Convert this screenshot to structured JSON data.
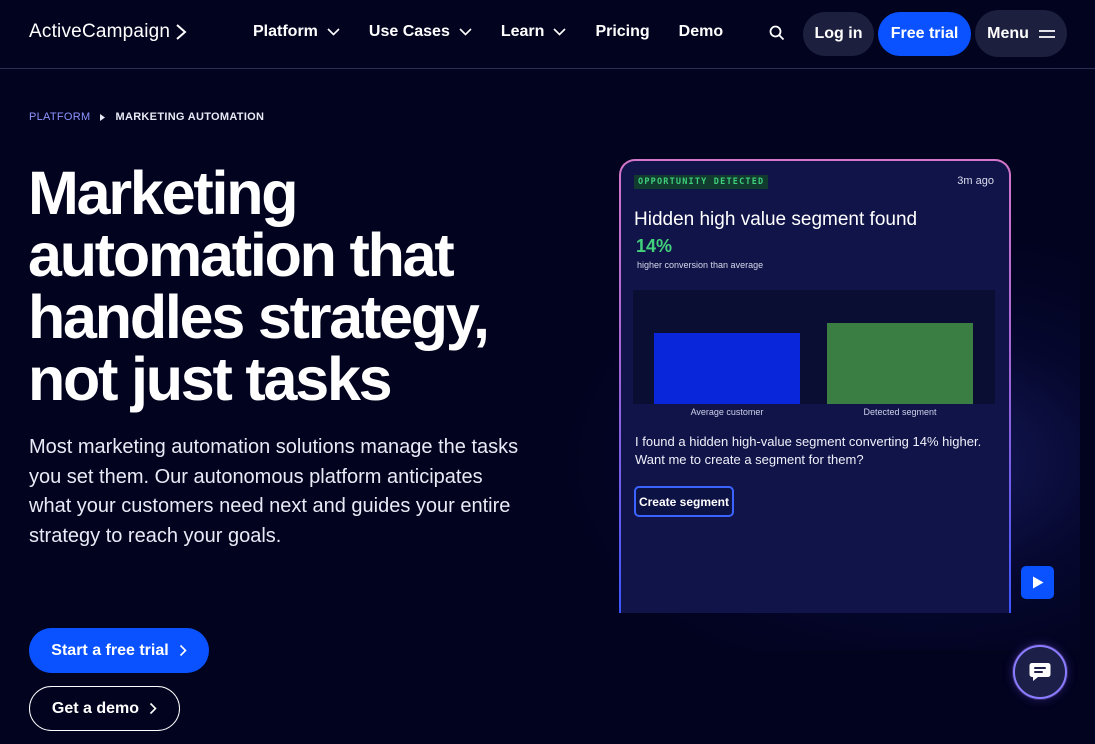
{
  "brand": {
    "name": "ActiveCampaign",
    "chevron_icon": "chevron-right-icon",
    "primary_color": "#0a52ff",
    "background_color": "#02031f"
  },
  "nav": {
    "links": [
      {
        "label": "Platform",
        "has_dropdown": true
      },
      {
        "label": "Use Cases",
        "has_dropdown": true
      },
      {
        "label": "Learn",
        "has_dropdown": true
      },
      {
        "label": "Pricing",
        "has_dropdown": false
      },
      {
        "label": "Demo",
        "has_dropdown": false
      }
    ],
    "search_icon": "search-icon",
    "login_label": "Log in",
    "free_trial_label": "Free trial",
    "menu_label": "Menu",
    "menu_icon": "hamburger-icon"
  },
  "breadcrumb": {
    "parent": "PLATFORM",
    "current": "MARKETING AUTOMATION"
  },
  "hero": {
    "title_lines": [
      "Marketing",
      "automation that",
      "handles strategy,",
      "not just tasks"
    ],
    "description": "Most marketing automation solutions manage the tasks you set them. Our autonomous platform anticipates what your customers need next and guides your entire strategy to reach your goals.",
    "primary_cta": "Start a free trial",
    "secondary_cta": "Get a demo"
  },
  "card": {
    "badge": "OPPORTUNITY DETECTED",
    "time": "3m ago",
    "title": "Hidden high value segment found",
    "stat": "14%",
    "stat_caption": "higher conversion than average",
    "message": "I found a hidden high-value segment converting 14% higher. Want me to create a segment for them?",
    "action_label": "Create segment"
  },
  "chart_data": {
    "type": "bar",
    "categories": [
      "Average customer",
      "Detected segment"
    ],
    "values": [
      100,
      114
    ],
    "colors": [
      "#0a26db",
      "#3a7e44"
    ],
    "ylim": [
      0,
      160
    ],
    "grid": false,
    "title": "",
    "xlabel": "",
    "ylabel": ""
  },
  "widgets": {
    "play_icon": "play-icon",
    "chat_icon": "chat-icon"
  }
}
